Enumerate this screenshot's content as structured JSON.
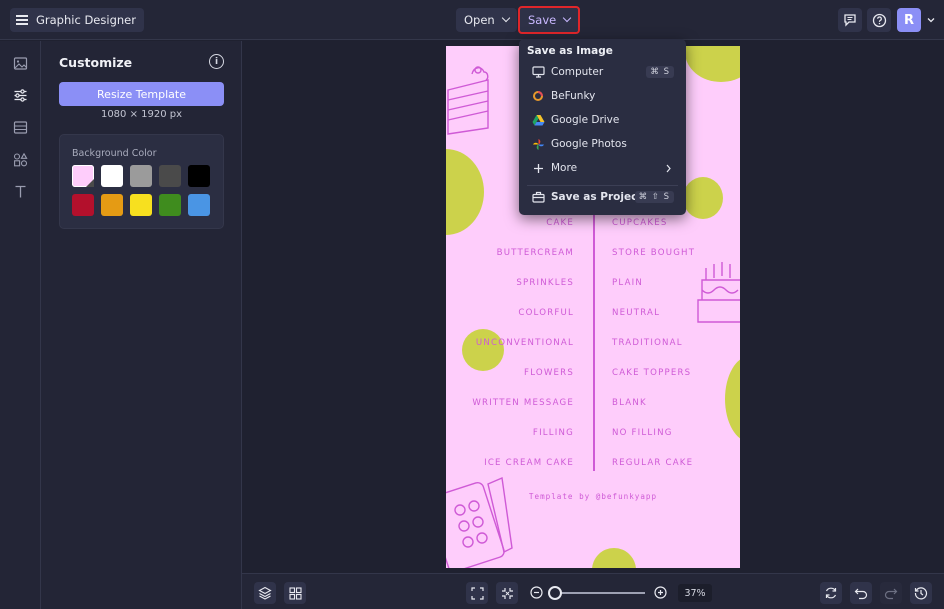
{
  "app": {
    "title": "Graphic Designer"
  },
  "toolbar": {
    "open_label": "Open",
    "save_label": "Save",
    "avatar_initial": "R"
  },
  "panel": {
    "title": "Customize",
    "resize_label": "Resize Template",
    "dimensions": "1080 × 1920 px",
    "bg_label": "Background Color",
    "swatches": [
      "#fecdfb",
      "#ffffff",
      "#9b9b9b",
      "#4a4a4a",
      "#000000",
      "#b3102c",
      "#e59b14",
      "#f7e01f",
      "#3f8c1e",
      "#4a95e4"
    ]
  },
  "save_menu": {
    "heading": "Save as Image",
    "items": [
      {
        "label": "Computer",
        "shortcut": "⌘ S",
        "icon": "monitor-icon"
      },
      {
        "label": "BeFunky",
        "icon": "befunky-icon"
      },
      {
        "label": "Google Drive",
        "icon": "google-drive-icon"
      },
      {
        "label": "Google Photos",
        "icon": "google-photos-icon"
      },
      {
        "label": "More",
        "icon": "plus-icon"
      }
    ],
    "project": {
      "label": "Save as Project",
      "shortcut": "⌘ ⇧ S"
    }
  },
  "design": {
    "left_items": [
      "CAKE",
      "BUTTERCREAM",
      "SPRINKLES",
      "COLORFUL",
      "UNCONVENTIONAL",
      "FLOWERS",
      "WRITTEN MESSAGE",
      "FILLING",
      "ICE CREAM CAKE"
    ],
    "right_items": [
      "CUPCAKES",
      "STORE BOUGHT",
      "PLAIN",
      "NEUTRAL",
      "TRADITIONAL",
      "CAKE TOPPERS",
      "BLANK",
      "NO FILLING",
      "REGULAR CAKE"
    ],
    "credit": "Template by @befunkyapp",
    "colors": {
      "bg": "#fecdfb",
      "accent": "#cf5ad6",
      "dot": "#ccd24b"
    }
  },
  "zoom": {
    "value": "37%",
    "level": 0.0
  }
}
